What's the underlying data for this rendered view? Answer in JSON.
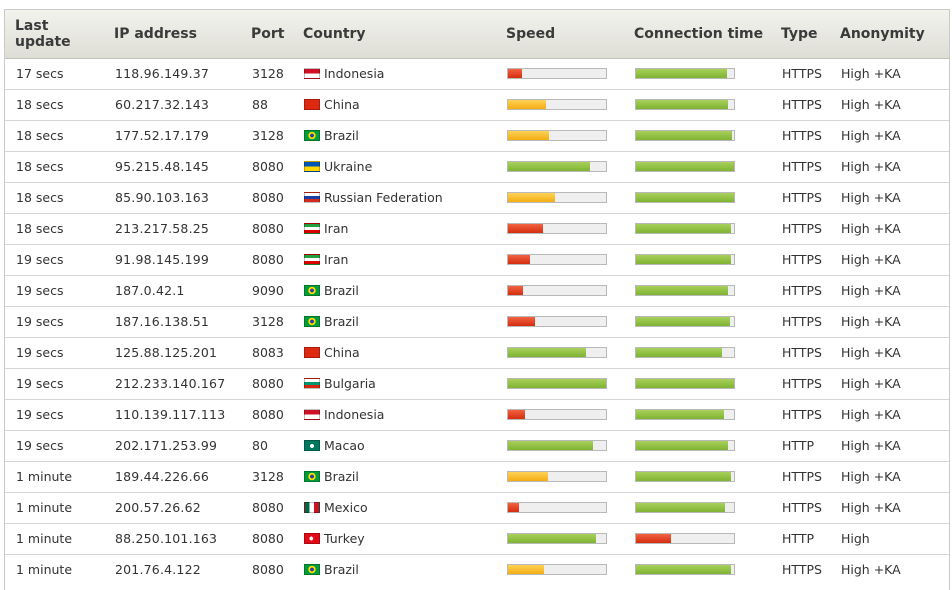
{
  "columns": {
    "last_update": "Last update",
    "ip_address": "IP address",
    "port": "Port",
    "country": "Country",
    "speed": "Speed",
    "connection_time": "Connection time",
    "type": "Type",
    "anonymity": "Anonymity"
  },
  "colors": {
    "green": "#7fb334",
    "orange": "#f3ad15",
    "red": "#d42d10"
  },
  "rows": [
    {
      "last_update": "17 secs",
      "ip": "118.96.149.37",
      "port": "3128",
      "flag": "ID",
      "country": "Indonesia",
      "speed": 0.14,
      "speed_level": "red",
      "conn": 0.93,
      "conn_level": "green",
      "type": "HTTPS",
      "anonymity": "High +KA"
    },
    {
      "last_update": "18 secs",
      "ip": "60.217.32.143",
      "port": "88",
      "flag": "CN",
      "country": "China",
      "speed": 0.39,
      "speed_level": "orange",
      "conn": 0.94,
      "conn_level": "green",
      "type": "HTTPS",
      "anonymity": "High +KA"
    },
    {
      "last_update": "18 secs",
      "ip": "177.52.17.179",
      "port": "3128",
      "flag": "BR",
      "country": "Brazil",
      "speed": 0.42,
      "speed_level": "orange",
      "conn": 0.98,
      "conn_level": "green",
      "type": "HTTPS",
      "anonymity": "High +KA"
    },
    {
      "last_update": "18 secs",
      "ip": "95.215.48.145",
      "port": "8080",
      "flag": "UA",
      "country": "Ukraine",
      "speed": 0.84,
      "speed_level": "green",
      "conn": 1.0,
      "conn_level": "green",
      "type": "HTTPS",
      "anonymity": "High +KA"
    },
    {
      "last_update": "18 secs",
      "ip": "85.90.103.163",
      "port": "8080",
      "flag": "RU",
      "country": "Russian Federation",
      "speed": 0.48,
      "speed_level": "orange",
      "conn": 1.0,
      "conn_level": "green",
      "type": "HTTPS",
      "anonymity": "High +KA"
    },
    {
      "last_update": "18 secs",
      "ip": "213.217.58.25",
      "port": "8080",
      "flag": "IR",
      "country": "Iran",
      "speed": 0.36,
      "speed_level": "red",
      "conn": 0.97,
      "conn_level": "green",
      "type": "HTTPS",
      "anonymity": "High +KA"
    },
    {
      "last_update": "19 secs",
      "ip": "91.98.145.199",
      "port": "8080",
      "flag": "IR",
      "country": "Iran",
      "speed": 0.22,
      "speed_level": "red",
      "conn": 0.97,
      "conn_level": "green",
      "type": "HTTPS",
      "anonymity": "High +KA"
    },
    {
      "last_update": "19 secs",
      "ip": "187.0.42.1",
      "port": "9090",
      "flag": "BR",
      "country": "Brazil",
      "speed": 0.15,
      "speed_level": "red",
      "conn": 0.94,
      "conn_level": "green",
      "type": "HTTPS",
      "anonymity": "High +KA"
    },
    {
      "last_update": "19 secs",
      "ip": "187.16.138.51",
      "port": "3128",
      "flag": "BR",
      "country": "Brazil",
      "speed": 0.28,
      "speed_level": "red",
      "conn": 0.96,
      "conn_level": "green",
      "type": "HTTPS",
      "anonymity": "High +KA"
    },
    {
      "last_update": "19 secs",
      "ip": "125.88.125.201",
      "port": "8083",
      "flag": "CN",
      "country": "China",
      "speed": 0.8,
      "speed_level": "green",
      "conn": 0.88,
      "conn_level": "green",
      "type": "HTTPS",
      "anonymity": "High +KA"
    },
    {
      "last_update": "19 secs",
      "ip": "212.233.140.167",
      "port": "8080",
      "flag": "BG",
      "country": "Bulgaria",
      "speed": 1.0,
      "speed_level": "green",
      "conn": 1.0,
      "conn_level": "green",
      "type": "HTTPS",
      "anonymity": "High +KA"
    },
    {
      "last_update": "19 secs",
      "ip": "110.139.117.113",
      "port": "8080",
      "flag": "ID",
      "country": "Indonesia",
      "speed": 0.17,
      "speed_level": "red",
      "conn": 0.9,
      "conn_level": "green",
      "type": "HTTPS",
      "anonymity": "High +KA"
    },
    {
      "last_update": "19 secs",
      "ip": "202.171.253.99",
      "port": "80",
      "flag": "MO",
      "country": "Macao",
      "speed": 0.87,
      "speed_level": "green",
      "conn": 0.94,
      "conn_level": "green",
      "type": "HTTP",
      "anonymity": "High +KA"
    },
    {
      "last_update": "1 minute",
      "ip": "189.44.226.66",
      "port": "3128",
      "flag": "BR",
      "country": "Brazil",
      "speed": 0.41,
      "speed_level": "orange",
      "conn": 0.97,
      "conn_level": "green",
      "type": "HTTPS",
      "anonymity": "High +KA"
    },
    {
      "last_update": "1 minute",
      "ip": "200.57.26.62",
      "port": "8080",
      "flag": "MX",
      "country": "Mexico",
      "speed": 0.11,
      "speed_level": "red",
      "conn": 0.91,
      "conn_level": "green",
      "type": "HTTPS",
      "anonymity": "High +KA"
    },
    {
      "last_update": "1 minute",
      "ip": "88.250.101.163",
      "port": "8080",
      "flag": "TR",
      "country": "Turkey",
      "speed": 0.9,
      "speed_level": "green",
      "conn": 0.36,
      "conn_level": "red",
      "type": "HTTP",
      "anonymity": "High"
    },
    {
      "last_update": "1 minute",
      "ip": "201.76.4.122",
      "port": "8080",
      "flag": "BR",
      "country": "Brazil",
      "speed": 0.37,
      "speed_level": "orange",
      "conn": 0.97,
      "conn_level": "green",
      "type": "HTTPS",
      "anonymity": "High +KA"
    }
  ]
}
